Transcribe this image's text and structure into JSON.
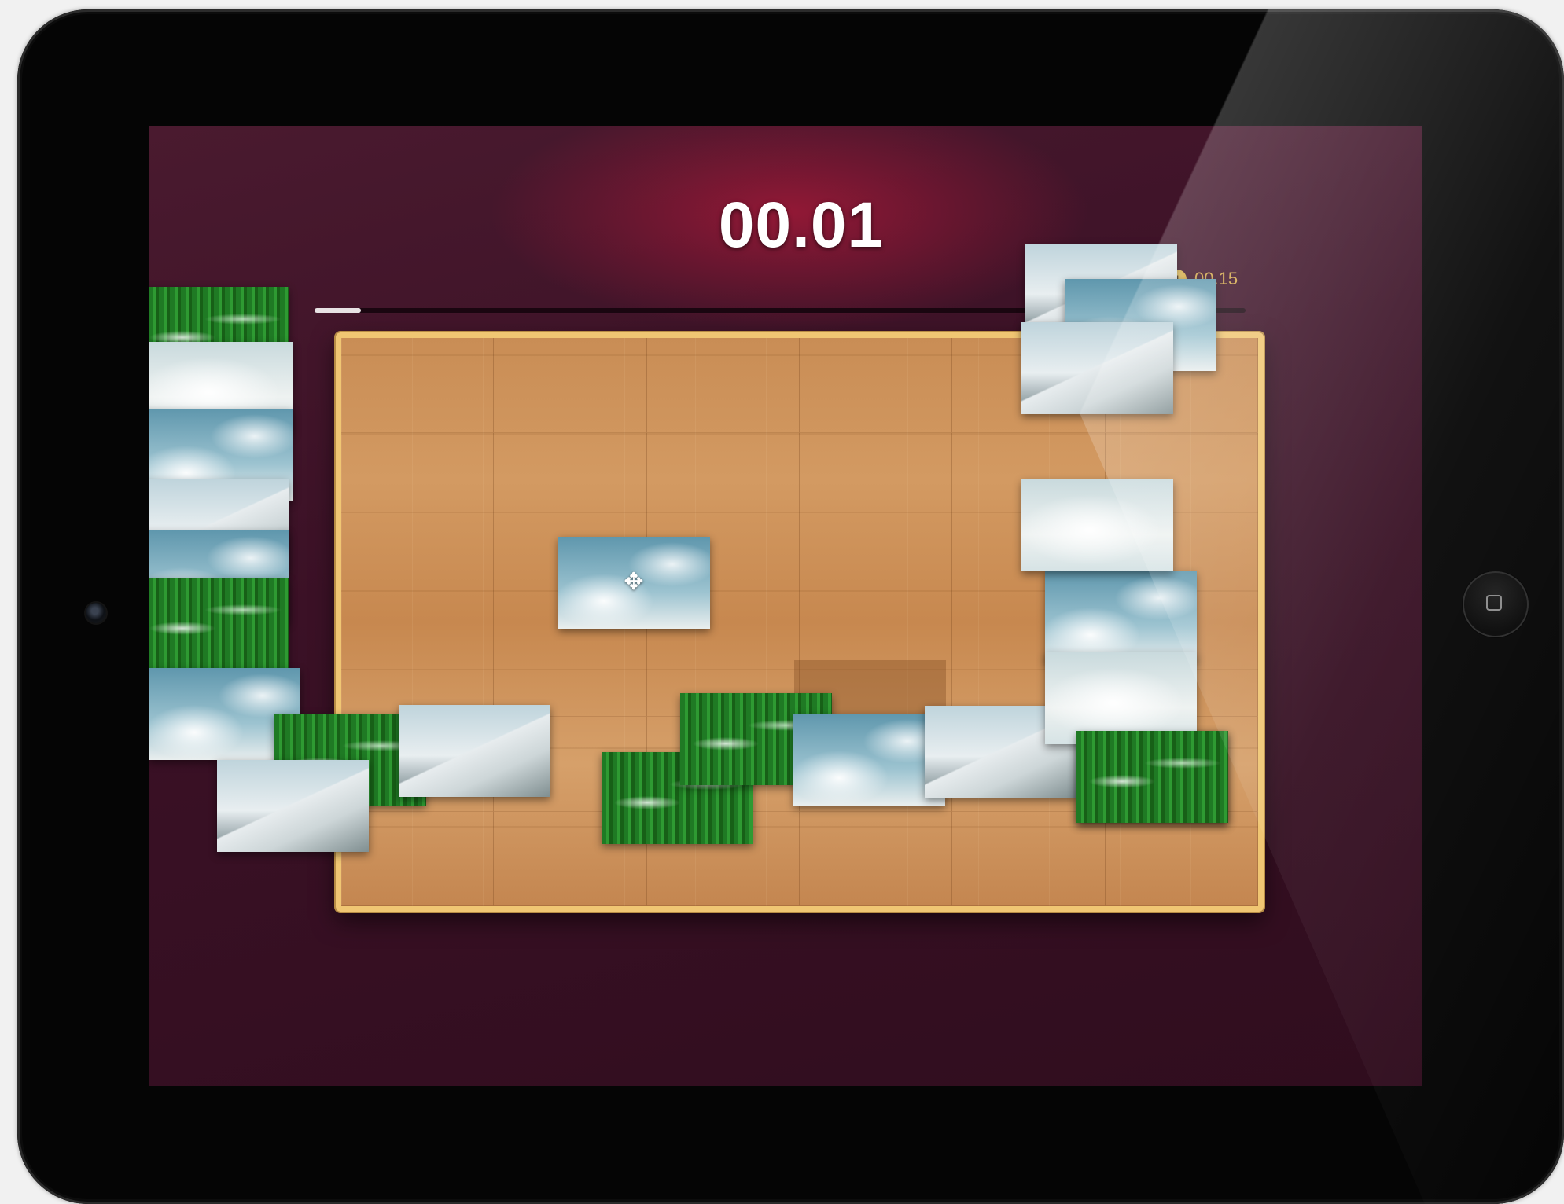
{
  "game": {
    "timer": "00.01",
    "best": {
      "badge": "1",
      "time": "00.15"
    },
    "progress": 0.05
  },
  "pieces": [
    {
      "id": "loose-1",
      "type": "grass"
    },
    {
      "id": "loose-2",
      "type": "cloud"
    },
    {
      "id": "loose-3",
      "type": "sky"
    },
    {
      "id": "loose-4",
      "type": "mountain"
    },
    {
      "id": "loose-5",
      "type": "sky"
    },
    {
      "id": "loose-6",
      "type": "grass"
    },
    {
      "id": "loose-7",
      "type": "sky"
    },
    {
      "id": "loose-8",
      "type": "grass"
    },
    {
      "id": "loose-9",
      "type": "mountain"
    },
    {
      "id": "loose-10",
      "type": "mountain"
    },
    {
      "id": "loose-11",
      "type": "grass"
    },
    {
      "id": "loose-12",
      "type": "grass"
    },
    {
      "id": "loose-13",
      "type": "sky"
    },
    {
      "id": "loose-14",
      "type": "mountain"
    },
    {
      "id": "loose-15",
      "type": "grass"
    },
    {
      "id": "loose-16",
      "type": "sky"
    },
    {
      "id": "loose-17",
      "type": "mountain"
    },
    {
      "id": "loose-18",
      "type": "sky"
    },
    {
      "id": "loose-19",
      "type": "mountain"
    },
    {
      "id": "loose-20",
      "type": "cloud"
    },
    {
      "id": "loose-21",
      "type": "cloud"
    },
    {
      "id": "loose-22",
      "type": "grass"
    }
  ],
  "active_piece": {
    "type": "sky",
    "icon": "move-icon"
  }
}
